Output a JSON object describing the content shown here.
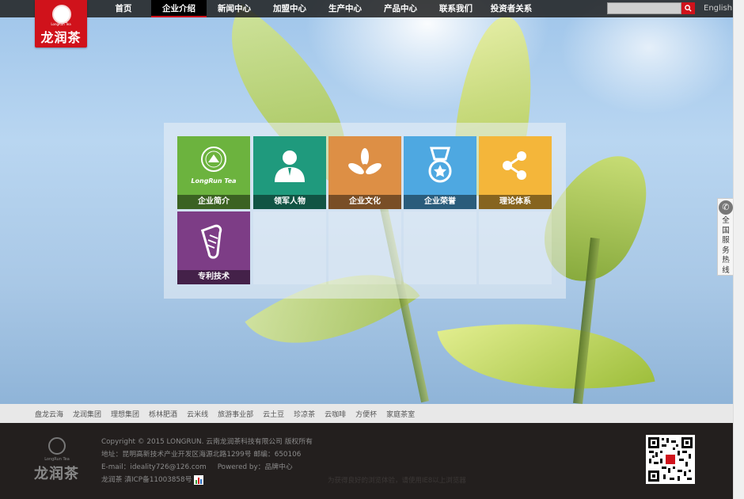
{
  "logo": {
    "name": "龙润茶",
    "sub": "LongRun Tea"
  },
  "nav": {
    "items": [
      "首页",
      "企业介绍",
      "新闻中心",
      "加盟中心",
      "生产中心",
      "产品中心",
      "联系我们",
      "投资者关系"
    ],
    "active_index": 1
  },
  "search": {
    "placeholder": ""
  },
  "lang": "English",
  "tiles": [
    {
      "label": "企业简介",
      "logo_text": "LongRun Tea",
      "color": "#6cb33e",
      "icon": "longrun-logo-icon"
    },
    {
      "label": "领军人物",
      "color": "#1f9a7d",
      "icon": "person-icon"
    },
    {
      "label": "企业文化",
      "color": "#dd8f45",
      "icon": "flower-icon"
    },
    {
      "label": "企业荣誉",
      "color": "#4ea8e1",
      "icon": "medal-icon"
    },
    {
      "label": "理论体系",
      "color": "#f4b63a",
      "icon": "share-icon"
    },
    {
      "label": "专利技术",
      "color": "#7d3d86",
      "icon": "document-icon"
    }
  ],
  "hotline": {
    "label": "全国服务热线"
  },
  "links": [
    "盘龙云海",
    "龙润集团",
    "理想集团",
    "栎林肥酒",
    "云米线",
    "旅游事业部",
    "云土豆",
    "珍凉茶",
    "云咖啡",
    "方便杯",
    "家庭茶室"
  ],
  "footer": {
    "copyright": "Copyright © 2015 LONGRUN. 云南龙润茶科技有限公司 版权所有",
    "address": "地址：昆明高新技术产业开发区海源北路1299号 邮编：650106",
    "email_powered": "E-mail：ideality726@126.com     Powered by：品牌中心",
    "icp": "龙润茶 滇ICP备11003858号",
    "browser_notice": "为获得良好的浏览体验，请使用IE8以上浏览器",
    "logo_name": "龙润茶",
    "logo_sub": "LongRun Tea"
  },
  "colors": {
    "brand_red": "#d0121b",
    "footer_bg": "#231f1e"
  }
}
